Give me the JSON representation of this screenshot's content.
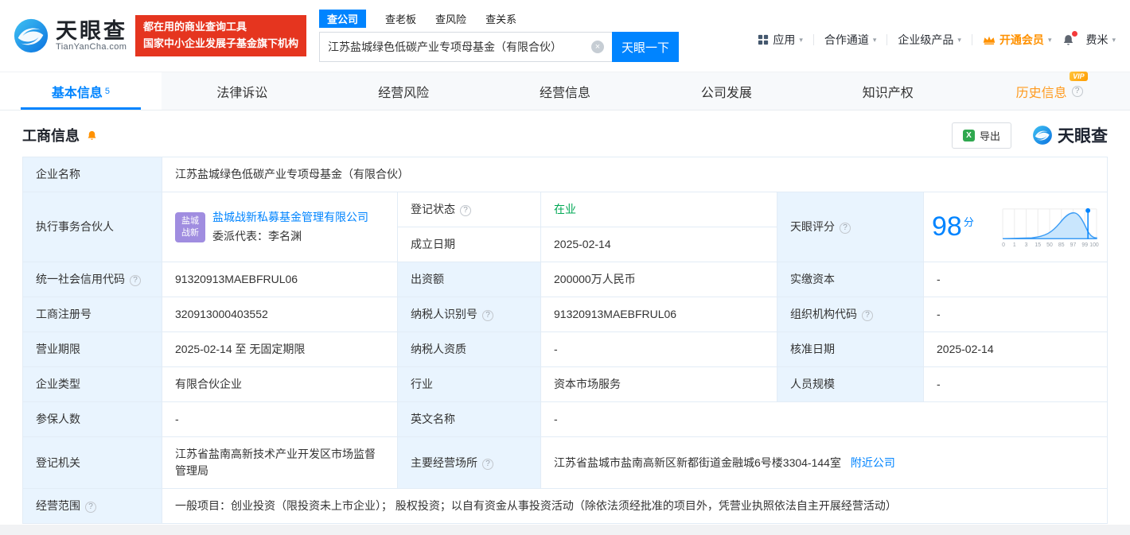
{
  "colors": {
    "accent_blue": "#0084ff",
    "vip_orange": "#ff9100",
    "status_green": "#00a854",
    "promo_red": "#e5351f",
    "partner_badge_purple": "#a08de0",
    "label_cell_blue": "#e9f4fe"
  },
  "brand": {
    "name": "天眼查",
    "domain": "TianYanCha.com"
  },
  "promo": {
    "line1": "都在用的商业查询工具",
    "line2": "国家中小企业发展子基金旗下机构"
  },
  "search": {
    "tabs": [
      "查公司",
      "查老板",
      "查风险",
      "查关系"
    ],
    "value": "江苏盐城绿色低碳产业专项母基金（有限合伙）",
    "submit": "天眼一下"
  },
  "topnav": {
    "apps": "应用",
    "coop": "合作通道",
    "enterprise": "企业级产品",
    "vip": "开通会员",
    "user": "费米"
  },
  "tabs": {
    "basic": "基本信息",
    "basic_count": "5",
    "legal": "法律诉讼",
    "risk": "经营风险",
    "operation": "经营信息",
    "development": "公司发展",
    "ip": "知识产权",
    "history": "历史信息",
    "history_vip": "VIP"
  },
  "section": {
    "title": "工商信息",
    "export": "导出",
    "brand": "天眼查"
  },
  "info": {
    "labels": {
      "name": "企业名称",
      "partner": "执行事务合伙人",
      "reg_status": "登记状态",
      "establish_date": "成立日期",
      "score": "天眼评分",
      "credit_code": "统一社会信用代码",
      "capital": "出资额",
      "paid_capital": "实缴资本",
      "reg_number": "工商注册号",
      "taxpayer_id": "纳税人识别号",
      "org_code": "组织机构代码",
      "term": "营业期限",
      "taxpayer_quality": "纳税人资质",
      "approval_date": "核准日期",
      "company_type": "企业类型",
      "industry": "行业",
      "staff_size": "人员规模",
      "insured_count": "参保人数",
      "english_name": "英文名称",
      "reg_authority": "登记机关",
      "business_address": "主要经营场所",
      "business_scope": "经营范围"
    },
    "values": {
      "name": "江苏盐城绿色低碳产业专项母基金（有限合伙）",
      "partner_badge_line1": "盐城",
      "partner_badge_line2": "战新",
      "partner_company": "盐城战新私募基金管理有限公司",
      "partner_rep": "委派代表：李名渊",
      "reg_status": "在业",
      "establish_date": "2025-02-14",
      "score": "98",
      "score_unit": "分",
      "credit_code": "91320913MAEBFRUL06",
      "capital": "200000万人民币",
      "paid_capital": "-",
      "reg_number": "320913000403552",
      "taxpayer_id": "91320913MAEBFRUL06",
      "org_code": "-",
      "term": "2025-02-14 至 无固定期限",
      "taxpayer_quality": "-",
      "approval_date": "2025-02-14",
      "company_type": "有限合伙企业",
      "industry": "资本市场服务",
      "staff_size": "-",
      "insured_count": "-",
      "english_name": "-",
      "reg_authority": "江苏省盐南高新技术产业开发区市场监督管理局",
      "business_address": "江苏省盐城市盐南高新区新都街道金融城6号楼3304-144室",
      "nearby_link": "附近公司",
      "business_scope": "一般项目：创业投资（限投资未上市企业）； 股权投资；以自有资金从事投资活动（除依法须经批准的项目外，凭营业执照依法自主开展经营活动）"
    },
    "score_ticks": [
      "0",
      "1",
      "3",
      "15",
      "50",
      "85",
      "97",
      "99",
      "100"
    ]
  }
}
